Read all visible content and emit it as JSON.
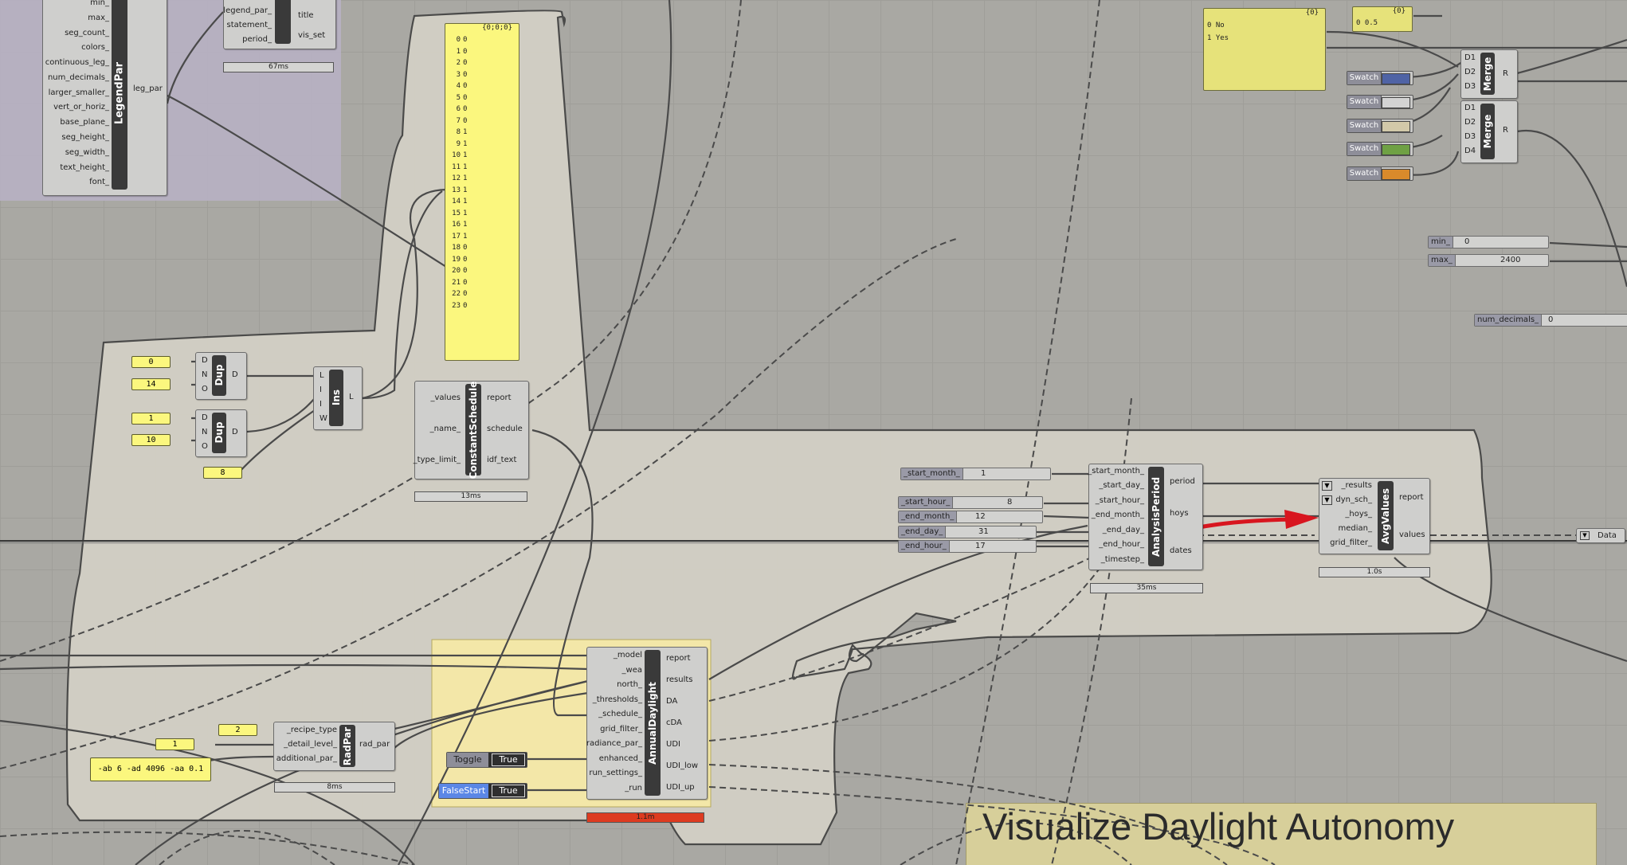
{
  "legend_par": {
    "inputs": [
      "min_",
      "max_",
      "seg_count_",
      "colors_",
      "continuous_leg_",
      "num_decimals_",
      "larger_smaller_",
      "vert_or_horiz_",
      "base_plane_",
      "seg_height_",
      "seg_width_",
      "text_height_",
      "font_"
    ],
    "name": "LegendPar",
    "output": "leg_par"
  },
  "vis_set": {
    "inputs": [
      "legend_par_",
      "statement_",
      "period_"
    ],
    "outputs": [
      "title",
      "vis_set"
    ],
    "timer": "67ms"
  },
  "panel_schedule": {
    "header": "{0;0;0}",
    "rows": [
      {
        "i": "0",
        "v": "0"
      },
      {
        "i": "1",
        "v": "0"
      },
      {
        "i": "2",
        "v": "0"
      },
      {
        "i": "3",
        "v": "0"
      },
      {
        "i": "4",
        "v": "0"
      },
      {
        "i": "5",
        "v": "0"
      },
      {
        "i": "6",
        "v": "0"
      },
      {
        "i": "7",
        "v": "0"
      },
      {
        "i": "8",
        "v": "1"
      },
      {
        "i": "9",
        "v": "1"
      },
      {
        "i": "10",
        "v": "1"
      },
      {
        "i": "11",
        "v": "1"
      },
      {
        "i": "12",
        "v": "1"
      },
      {
        "i": "13",
        "v": "1"
      },
      {
        "i": "14",
        "v": "1"
      },
      {
        "i": "15",
        "v": "1"
      },
      {
        "i": "16",
        "v": "1"
      },
      {
        "i": "17",
        "v": "1"
      },
      {
        "i": "18",
        "v": "0"
      },
      {
        "i": "19",
        "v": "0"
      },
      {
        "i": "20",
        "v": "0"
      },
      {
        "i": "21",
        "v": "0"
      },
      {
        "i": "22",
        "v": "0"
      },
      {
        "i": "23",
        "v": "0"
      }
    ]
  },
  "nums": {
    "a": "0",
    "b": "14",
    "c": "1",
    "d": "10",
    "e": "8",
    "recipe": "2",
    "detail": "1",
    "radpar_string": "-ab 6 -ad 4096 -aa 0.1"
  },
  "dup": {
    "name": "Dup",
    "inputs": [
      "D",
      "N",
      "O"
    ],
    "output": "D"
  },
  "ins": {
    "name": "Ins",
    "inputs": [
      "L",
      "I",
      "I",
      "W"
    ],
    "output": "L"
  },
  "constant_schedule": {
    "name": "ConstantSchedule",
    "inputs": [
      "_values",
      "_name_",
      "_type_limit_"
    ],
    "outputs": [
      "report",
      "schedule",
      "idf_text"
    ],
    "timer": "13ms"
  },
  "toggle_panel": {
    "header": "{0}",
    "rows": [
      {
        "i": "0",
        "v": "No"
      },
      {
        "i": "1",
        "v": "Yes"
      }
    ]
  },
  "value_panel": {
    "header": "{0}",
    "rows": [
      {
        "i": "0",
        "v": "0.5"
      }
    ]
  },
  "merge": {
    "name": "Merge",
    "inputs_a": [
      "D1",
      "D2",
      "D3"
    ],
    "inputs_b": [
      "D1",
      "D2",
      "D3",
      "D4"
    ],
    "output": "R"
  },
  "swatches": [
    {
      "label": "Swatch",
      "color": "#4f63a5"
    },
    {
      "label": "Swatch",
      "color": "#d3d3d3"
    },
    {
      "label": "Swatch",
      "color": "#d2c9a9"
    },
    {
      "label": "Swatch",
      "color": "#6fa144"
    },
    {
      "label": "Swatch",
      "color": "#d98a2b"
    }
  ],
  "sliders_right": [
    {
      "label": "min_",
      "value": "0"
    },
    {
      "label": "max_",
      "value": "2400"
    },
    {
      "label": "num_decimals_",
      "value": "0"
    }
  ],
  "analysis_sliders": [
    {
      "label": "_start_month_",
      "value": "1"
    },
    {
      "label": "_start_hour_",
      "value": "8"
    },
    {
      "label": "_end_month_",
      "value": "12"
    },
    {
      "label": "_end_day_",
      "value": "31"
    },
    {
      "label": "_end_hour_",
      "value": "17"
    }
  ],
  "analysis_period": {
    "name": "AnalysisPeriod",
    "inputs": [
      "_start_month_",
      "_start_day_",
      "_start_hour_",
      "_end_month_",
      "_end_day_",
      "_end_hour_",
      "_timestep_"
    ],
    "outputs": [
      "period",
      "hoys",
      "dates"
    ],
    "timer": "35ms"
  },
  "avg_values": {
    "name": "AvgValues",
    "inputs": [
      "_results",
      "dyn_sch_",
      "_hoys_",
      "median_",
      "grid_filter_"
    ],
    "outputs": [
      "report",
      "values"
    ],
    "timer": "1.0s"
  },
  "data_label": "Data",
  "radpar": {
    "name": "RadPar",
    "inputs": [
      "_recipe_type",
      "_detail_level_",
      "additional_par_"
    ],
    "output": "rad_par",
    "timer": "8ms"
  },
  "annual_daylight": {
    "name": "AnnualDaylight",
    "inputs": [
      "_model",
      "_wea",
      "north_",
      "_thresholds_",
      "_schedule_",
      "grid_filter_",
      "radiance_par_",
      "enhanced_",
      "run_settings_",
      "_run"
    ],
    "outputs": [
      "report",
      "results",
      "DA",
      "cDA",
      "UDI",
      "UDI_low",
      "UDI_up"
    ],
    "timer": "1.1m"
  },
  "toggles": [
    {
      "label": "Toggle",
      "value": "True",
      "color": "#8e8e99"
    },
    {
      "label": "FalseStart",
      "value": "True",
      "color": "#5b87e6"
    }
  ],
  "group_title": "Visualize Daylight Autonomy",
  "colors": {
    "canvas": "#a9a8a3",
    "panel": "#fbf77e",
    "legend_group": "#b9b1c6",
    "annual_group": "#f3e7a8",
    "title_group": "#dcd39b",
    "annotation_arrow": "#d8161f",
    "timer_error": "#dd3b20"
  }
}
